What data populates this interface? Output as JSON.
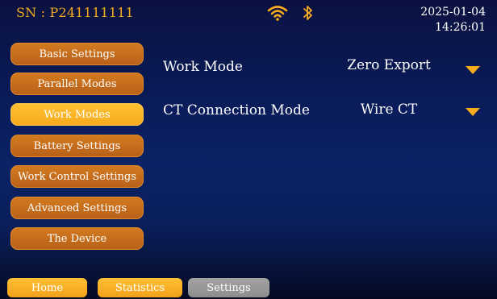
{
  "header": {
    "serial": "SN : P241111111",
    "date": "2025-01-04",
    "time": "14:26:01",
    "wifi_icon": "wifi-icon",
    "bluetooth_icon": "bluetooth-icon"
  },
  "sidebar": {
    "items": [
      {
        "label": "Basic Settings",
        "active": false
      },
      {
        "label": "Parallel Modes",
        "active": false
      },
      {
        "label": "Work Modes",
        "active": true
      },
      {
        "label": "Battery Settings",
        "active": false
      },
      {
        "label": "Work Control Settings",
        "active": false
      },
      {
        "label": "Advanced Settings",
        "active": false
      },
      {
        "label": "The Device",
        "active": false
      }
    ]
  },
  "settings": {
    "rows": [
      {
        "label": "Work Mode",
        "value": "Zero Export",
        "control_icon": "chevron-down-icon"
      },
      {
        "label": "CT Connection Mode",
        "value": "Wire CT",
        "control_icon": "chevron-down-icon"
      }
    ]
  },
  "bottom_nav": {
    "tabs": [
      {
        "label": "Home",
        "active": false
      },
      {
        "label": "Statistics",
        "active": false
      },
      {
        "label": "Settings",
        "active": true
      }
    ]
  },
  "colors": {
    "accent_orange": "#f7ab1e",
    "sidebar_orange": "#c86c1c",
    "active_tab_gray": "#999999",
    "background_blue": "#0a1f5c"
  }
}
